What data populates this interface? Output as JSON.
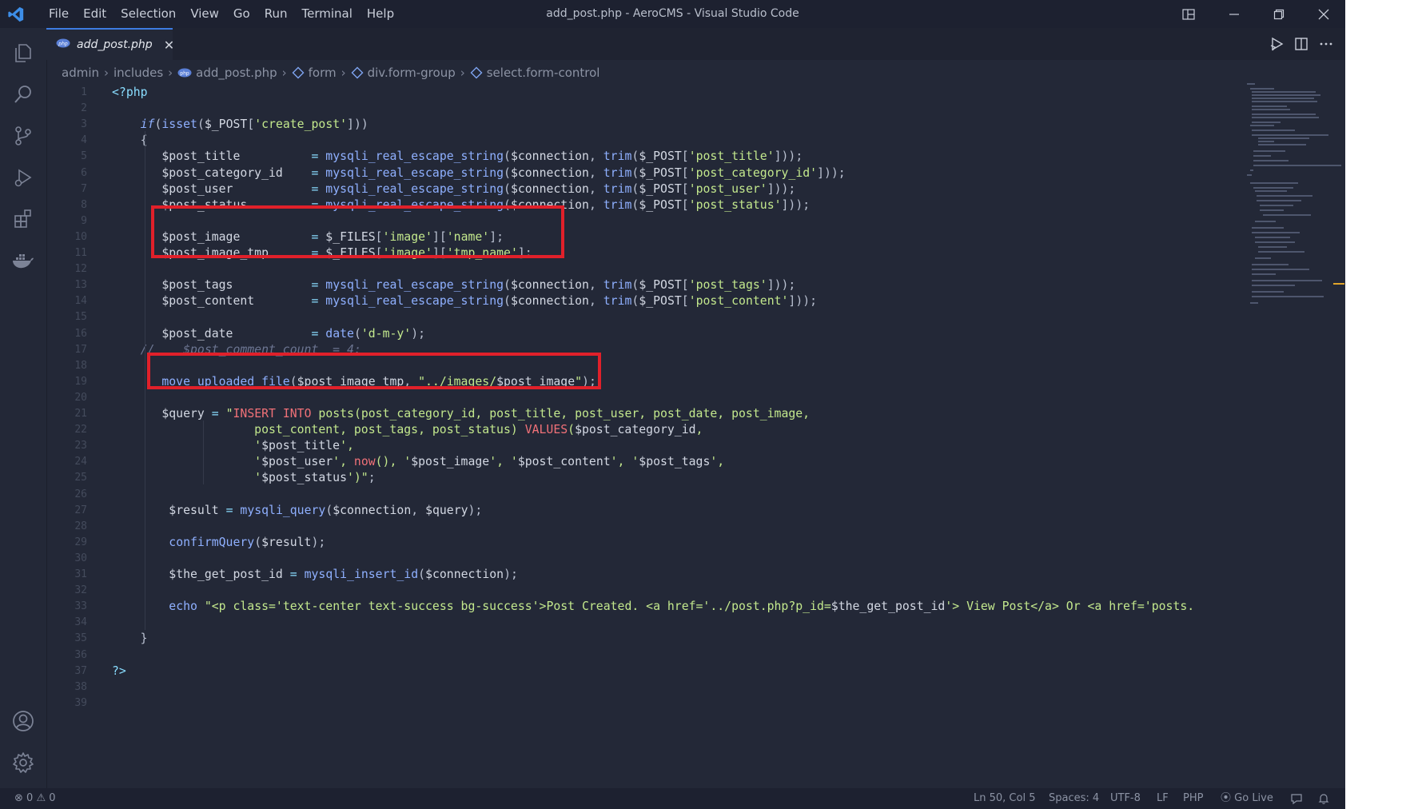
{
  "window": {
    "title": "add_post.php - AeroCMS - Visual Studio Code",
    "menu": [
      "File",
      "Edit",
      "Selection",
      "View",
      "Go",
      "Run",
      "Terminal",
      "Help"
    ]
  },
  "tab": {
    "label": "add_post.php",
    "close": "✕"
  },
  "breadcrumb": [
    "admin",
    "includes",
    "add_post.php",
    "form",
    "div.form-group",
    "select.form-control"
  ],
  "icons": {
    "activity": [
      "explorer-icon",
      "search-icon",
      "source-control-icon",
      "run-debug-icon",
      "extensions-icon",
      "docker-icon"
    ],
    "activity_bottom": [
      "account-icon",
      "settings-gear-icon"
    ]
  },
  "code": {
    "line_numbers": [
      "1",
      "2",
      "3",
      "4",
      "5",
      "6",
      "7",
      "8",
      "9",
      "10",
      "11",
      "12",
      "13",
      "14",
      "15",
      "16",
      "17",
      "18",
      "19",
      "20",
      "21",
      "22",
      "23",
      "24",
      "25",
      "26",
      "27",
      "28",
      "29",
      "30",
      "31",
      "32",
      "33",
      "34",
      "35",
      "36",
      "37",
      "38",
      "39"
    ]
  },
  "highlight_color": "#e0202a",
  "status": {
    "errors": "0",
    "warnings": "0",
    "position": "Ln 50, Col 5",
    "spaces": "Spaces: 4",
    "encoding": "UTF-8",
    "eol": "LF",
    "language": "PHP",
    "golive": "Go Live"
  }
}
